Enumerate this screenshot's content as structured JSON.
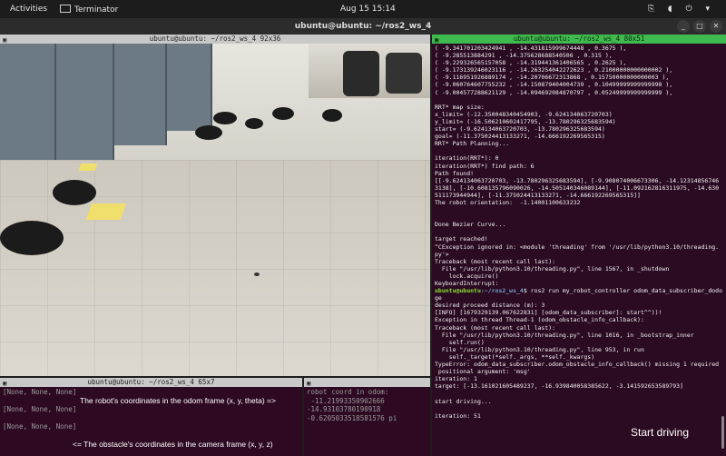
{
  "topbar": {
    "activities": "Activities",
    "app": "Terminator",
    "clock": "Aug 15  15:14",
    "sys_icons": "⎘ ◖ ⏻ ▾"
  },
  "window": {
    "title": "ubuntu@ubuntu: ~/ros2_ws_4"
  },
  "panes": {
    "camera": {
      "title": "ubuntu@ubuntu: ~/ros2_ws_4 92x36"
    },
    "right": {
      "title": "ubuntu@ubuntu: ~/ros2_ws_4 80x51"
    },
    "bottom_left": {
      "title": "ubuntu@ubuntu: ~/ros2_ws_4 65x7"
    }
  },
  "right_lines": [
    "( -9.341701203424941 , -14.431815999674448 , 0.3675 ),",
    "( -9.285513884291 , -14.375628688540506 , 0.315 ),",
    "( -9.229326565157058 , -14.319441361406565 , 0.2625 ),",
    "( -9.173139246023116 , -14.263254042272623 , 0.21000000000000002 ),",
    "( -9.116951926889174 , -14.20706672313868 , 0.15750000000000003 ),",
    "( -9.060764607755232 , -14.150879404004739 , 0.10499999999999998 ),",
    "( -9.004577288621129 , -14.094692084870797 , 0.05249999999999999 ),",
    "",
    "RRT* map size:",
    "x_limit= (-12.350048340454903, -9.624134063720703)",
    "y_limit= (-16.506210602417795, -13.780296325683594)",
    "start= (-9.624134063720703, -13.780296325683594)",
    "goal= (-11.375024413133271, -14.666192269565315)",
    "RRT* Path Planning...",
    "",
    "iteration(RRT*): 0",
    "iteration(RRT*) find path: 6",
    "Path found!",
    "[[-9.624134063720703, -13.780296325683594], [-9.908074006673306, -14.12314856746",
    "3138], [-10.608135796090026, -14.505140346089144], [-11.092162816311975, -14.630",
    "511173944944], [-11.375024413133271, -14.666192269565315]]",
    "The robot orientation:  -1.14001100633232",
    "",
    "",
    "Done Bezier Curve...",
    "",
    "target reached!",
    "^CException ignored in: <module 'threading' from '/usr/lib/python3.10/threading.",
    "py'>",
    "Traceback (most recent call last):",
    "  File \"/usr/lib/python3.10/threading.py\", line 1567, in _shutdown",
    "    lock.acquire()",
    "KeyboardInterrupt:",
    "",
    "ge",
    "desired proceed distance (m): 3",
    "[INFO] [1679329139.067622831] [odom_data_subscriber]: start^^))!",
    "Exception in thread Thread-1 (odom_obstacle_info_callback):",
    "Traceback (most recent call last):",
    "  File \"/usr/lib/python3.10/threading.py\", line 1016, in _bootstrap_inner",
    "    self.run()",
    "  File \"/usr/lib/python3.10/threading.py\", line 953, in run",
    "    self._target(*self._args, **self._kwargs)",
    "TypeError: odom_data_subscriber.odom_obstacle_info_callback() missing 1 required",
    " positional argument: 'msg'",
    "iteration: 1",
    "target: [-13.161021605489237, -16.939840058385622, -3.141592653589793]",
    "",
    "start driving...",
    "",
    "iteration: 51"
  ],
  "prompt_line": {
    "user": "ubuntu@ubuntu",
    "path": ":~/ros2_ws_4",
    "cmd": "$ ros2 run my_robot_controller odom_data_subscriber_dodo"
  },
  "bottom_left_lines": [
    "[None, None, None]",
    "",
    "[None, None, None]",
    "",
    "[None, None, None]"
  ],
  "odom_lines": [
    "robot coord in odom:",
    " -11.21993350902666",
    "-14.93103780190918",
    "-0.6205033518581576 pi"
  ],
  "annotations": {
    "odom_caption": "The robot's coordinates in the odom frame (x, y, theta) =>",
    "camera_caption": "<= The obstacle's coordinates in the camera frame (x, y, z)",
    "start_driving": "Start driving"
  },
  "colors": {
    "active_pane_header": "#3fba4f",
    "terminal_bg": "#2b0b22",
    "prompt_green": "#8ae234",
    "path_blue": "#729fcf"
  }
}
